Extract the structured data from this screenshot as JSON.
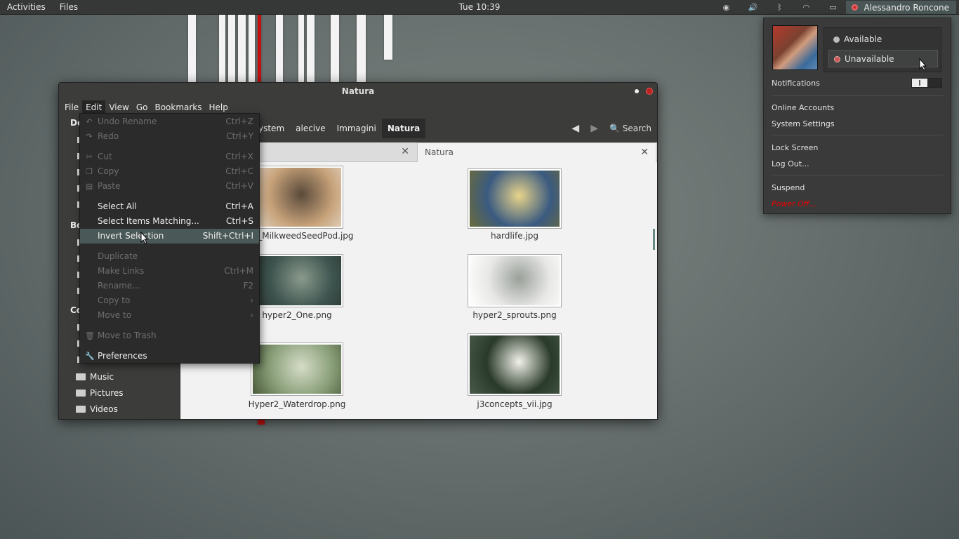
{
  "topbar": {
    "activities": "Activities",
    "app_menu": "Files",
    "clock": "Tue 10:39",
    "user_name": "Alessandro Roncone"
  },
  "window": {
    "title": "Natura",
    "menubar": [
      "File",
      "Edit",
      "View",
      "Go",
      "Bookmarks",
      "Help"
    ],
    "breadcrumbs": [
      "ystem",
      "alecive",
      "Immagini",
      "Natura"
    ],
    "search_label": "Search",
    "sidebar": {
      "heads": [
        "De",
        "Bo",
        "Co"
      ],
      "items": [
        "Music",
        "Pictures",
        "Videos"
      ]
    },
    "tabs": [
      {
        "label": ""
      },
      {
        "label": "Natura"
      }
    ],
    "files": [
      {
        "name": "wan_MilkweedSeedPod.jpg",
        "colors": [
          "#c7a27a",
          "#5a4a3a",
          "#e6dccd"
        ]
      },
      {
        "name": "hardlife.jpg",
        "colors": [
          "#3a5a80",
          "#e8d48a",
          "#6b6b3a"
        ]
      },
      {
        "name": "hyper2_One.png",
        "colors": [
          "#3f5550",
          "#8a9a8c",
          "#2a3530"
        ]
      },
      {
        "name": "hyper2_sprouts.png",
        "colors": [
          "#e8e8e6",
          "#9aa09a",
          "#ffffff"
        ]
      },
      {
        "name": "Hyper2_Waterdrop.png",
        "colors": [
          "#8aa07a",
          "#d6dcc8",
          "#4a5a3a"
        ]
      },
      {
        "name": "j3concepts_vii.jpg",
        "colors": [
          "#2a3a2a",
          "#f2f2ea",
          "#4a5a4a"
        ]
      }
    ]
  },
  "edit_menu": {
    "items": [
      {
        "label": "Undo Rename",
        "accel": "Ctrl+Z",
        "icon": "↶",
        "disabled": true
      },
      {
        "label": "Redo",
        "accel": "Ctrl+Y",
        "icon": "↷",
        "disabled": true
      },
      {
        "label": "Cut",
        "accel": "Ctrl+X",
        "icon": "✂",
        "disabled": true
      },
      {
        "label": "Copy",
        "accel": "Ctrl+C",
        "icon": "❐",
        "disabled": true
      },
      {
        "label": "Paste",
        "accel": "Ctrl+V",
        "icon": "▤",
        "disabled": true
      },
      {
        "label": "Select All",
        "accel": "Ctrl+A",
        "icon": "",
        "disabled": false
      },
      {
        "label": "Select Items Matching...",
        "accel": "Ctrl+S",
        "icon": "",
        "disabled": false
      },
      {
        "label": "Invert Selection",
        "accel": "Shift+Ctrl+I",
        "icon": "",
        "disabled": false,
        "highlighted": true
      },
      {
        "label": "Duplicate",
        "accel": "",
        "icon": "",
        "disabled": true
      },
      {
        "label": "Make Links",
        "accel": "Ctrl+M",
        "icon": "",
        "disabled": true
      },
      {
        "label": "Rename...",
        "accel": "F2",
        "icon": "",
        "disabled": true
      },
      {
        "label": "Copy to",
        "accel": "›",
        "icon": "",
        "disabled": true
      },
      {
        "label": "Move to",
        "accel": "›",
        "icon": "",
        "disabled": true
      },
      {
        "label": "Move to Trash",
        "accel": "",
        "icon": "🗑",
        "disabled": true
      },
      {
        "label": "Preferences",
        "accel": "",
        "icon": "🔧",
        "disabled": false
      }
    ]
  },
  "user_menu": {
    "status_available": "Available",
    "status_unavailable": "Unavailable",
    "notifications": "Notifications",
    "online_accounts": "Online Accounts",
    "system_settings": "System Settings",
    "lock_screen": "Lock Screen",
    "log_out": "Log Out...",
    "suspend": "Suspend",
    "power_off": "Power Off..."
  },
  "colors": {
    "accent_highlight": "#4a5957",
    "power_off": "#e00000",
    "unavailable_dot": "#cc3333"
  }
}
